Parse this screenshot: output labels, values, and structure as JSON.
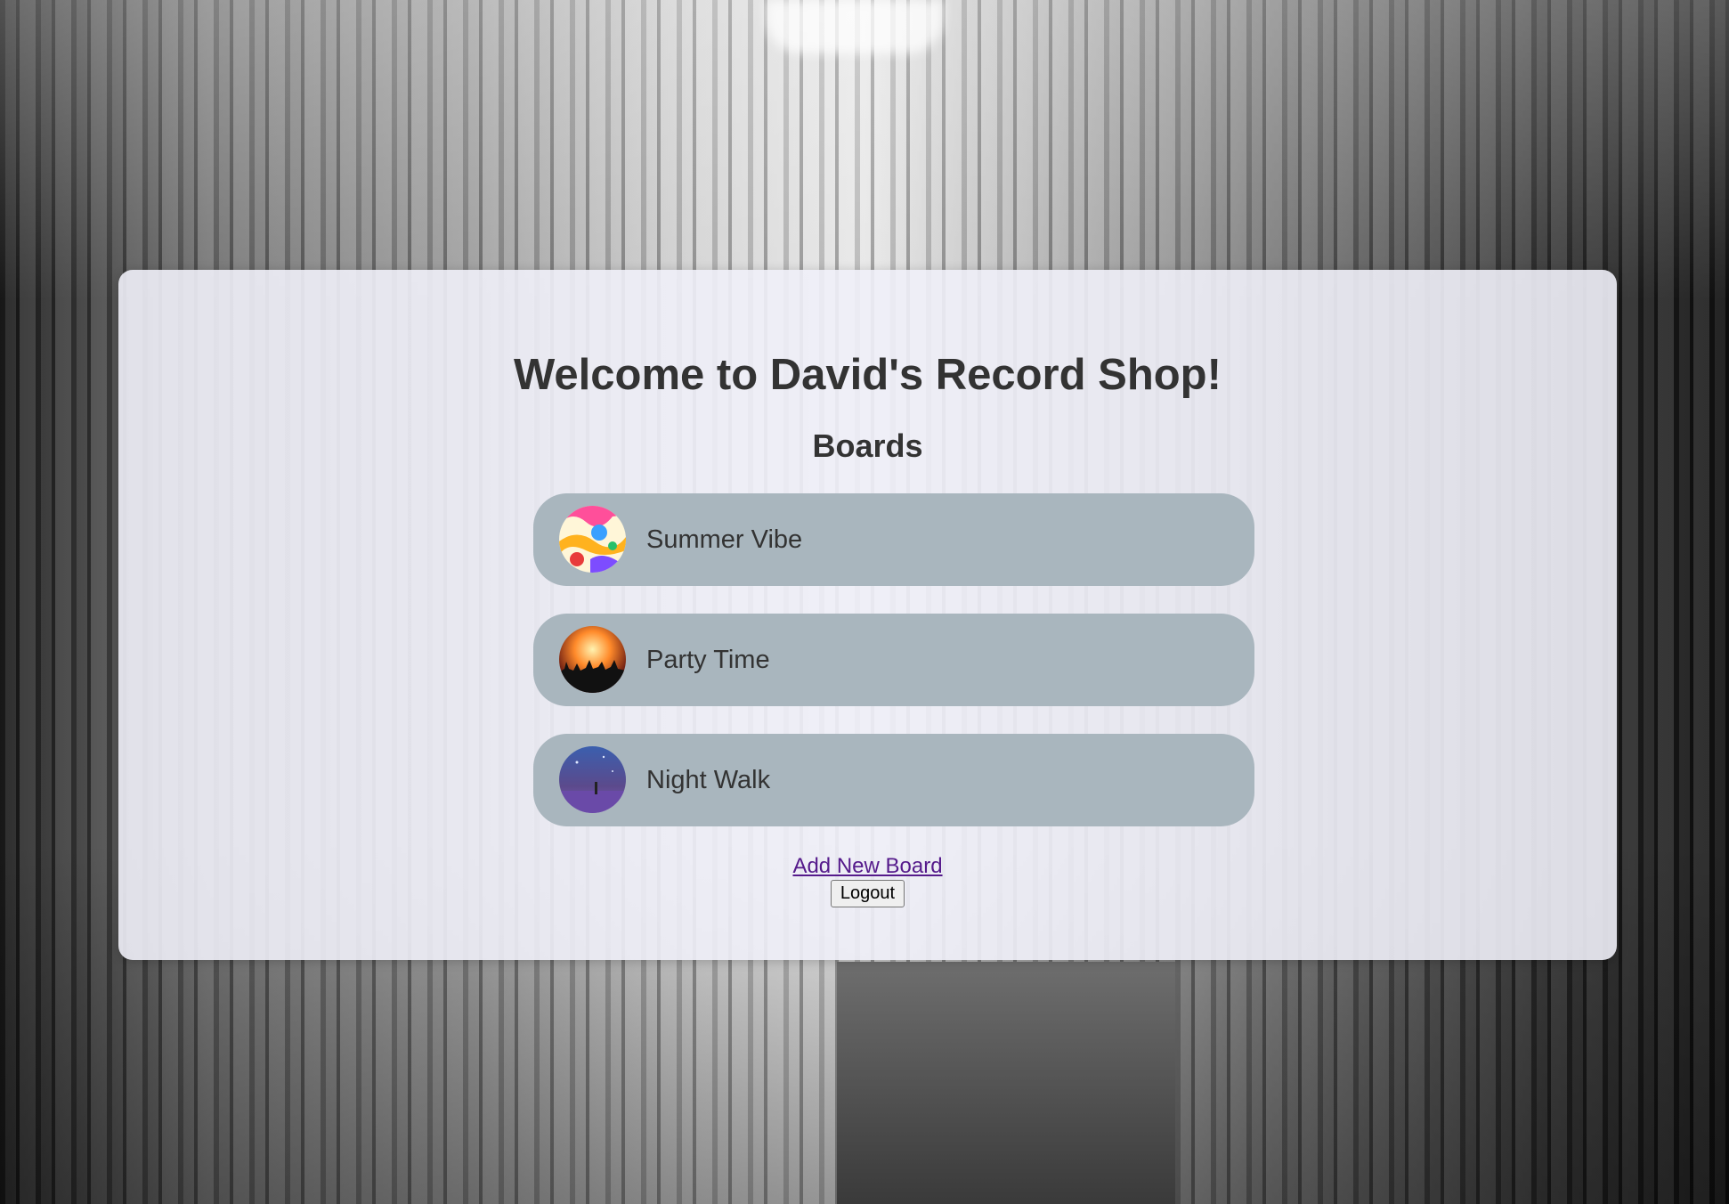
{
  "page": {
    "title": "Welcome to David's Record Shop!",
    "subtitle": "Boards"
  },
  "boards": [
    {
      "label": "Summer Vibe",
      "thumb_icon": "summer-vibe-art-icon"
    },
    {
      "label": "Party Time",
      "thumb_icon": "party-time-crowd-icon"
    },
    {
      "label": "Night Walk",
      "thumb_icon": "night-walk-art-icon"
    }
  ],
  "actions": {
    "add_board_label": "Add New Board",
    "logout_label": "Logout"
  },
  "colors": {
    "card_bg": "#f0f0f8",
    "board_bg": "#a9b6be",
    "text": "#333333",
    "link": "#551a8b"
  }
}
